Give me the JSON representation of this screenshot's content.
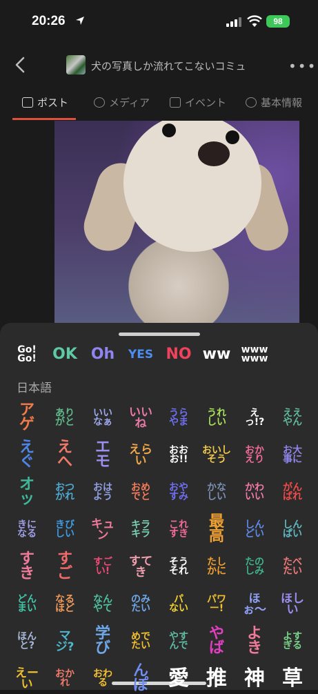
{
  "status": {
    "time": "20:26",
    "battery": "98"
  },
  "nav": {
    "group_title": "犬の写真しか流れてこないコミュ"
  },
  "tabs": [
    {
      "label": "ポスト",
      "icon": "post-icon"
    },
    {
      "label": "メディア",
      "icon": "media-icon"
    },
    {
      "label": "イベント",
      "icon": "calendar-icon"
    },
    {
      "label": "基本情報",
      "icon": "info-icon"
    }
  ],
  "colors": {
    "accent": "#e0503a",
    "sheet": "#2b2b2b",
    "background": "#1b1b1b"
  },
  "stickers": {
    "section_label": "日本語",
    "top_row": [
      {
        "text": "Go!\nGo!",
        "color": "#ffffff"
      },
      {
        "text": "OK",
        "color": "#5fc8a6"
      },
      {
        "text": "Oh",
        "color": "#8f84f0"
      },
      {
        "text": "YES",
        "color": "#4e8df0"
      },
      {
        "text": "NO",
        "color": "#f0425a"
      },
      {
        "text": "ww",
        "color": "#ffffff"
      },
      {
        "text": "www\nwww",
        "color": "#ffffff"
      }
    ],
    "grid": [
      [
        {
          "text": "アゲ",
          "color": "#f07a4a"
        },
        {
          "text": "あり\nがと",
          "color": "#5fb88a"
        },
        {
          "text": "いい\nなぁ",
          "color": "#9aa7e8"
        },
        {
          "text": "いいね",
          "color": "#e879a6"
        },
        {
          "text": "うら\nやま",
          "color": "#6f6ef0"
        },
        {
          "text": "うれ\nしい",
          "color": "#a8e05a"
        },
        {
          "text": "えっ!?",
          "color": "#ffffff"
        },
        {
          "text": "ええ\nやん",
          "color": "#5fb89a"
        }
      ],
      [
        {
          "text": "えぐ",
          "color": "#4f86e8"
        },
        {
          "text": "えへ",
          "color": "#f07a6a"
        },
        {
          "text": "エモ",
          "color": "#9c8ff0"
        },
        {
          "text": "えらい",
          "color": "#f0a64a"
        },
        {
          "text": "おお\nお!!",
          "color": "#ffffff"
        },
        {
          "text": "おいし\nそう",
          "color": "#f0c84a"
        },
        {
          "text": "おか\nえり",
          "color": "#f06a9a"
        },
        {
          "text": "お大\n事に",
          "color": "#8f84e8"
        }
      ],
      [
        {
          "text": "オッ",
          "color": "#3fb89a"
        },
        {
          "text": "おつ\nかれ",
          "color": "#4fa8d0"
        },
        {
          "text": "おは\nよう",
          "color": "#8f9ee0"
        },
        {
          "text": "おめ\nでと",
          "color": "#f07a5a"
        },
        {
          "text": "おや\nすみ",
          "color": "#6f6ef0"
        },
        {
          "text": "かな\nしい",
          "color": "#7a8fb0"
        },
        {
          "text": "かわ\nいい",
          "color": "#f07aa6"
        },
        {
          "text": "がん\nばれ",
          "color": "#f04a4a"
        }
      ],
      [
        {
          "text": "きに\nなる",
          "color": "#9f9fe8"
        },
        {
          "text": "きび\nしい",
          "color": "#3f9ae0"
        },
        {
          "text": "キュン",
          "color": "#f07a9a"
        },
        {
          "text": "キラ\nキラ",
          "color": "#7ad0b0"
        },
        {
          "text": "これ\nすき",
          "color": "#f06a9a"
        },
        {
          "text": "最高",
          "color": "#f0a030"
        },
        {
          "text": "しん\nどい",
          "color": "#5f8ae8"
        },
        {
          "text": "しん\nぱい",
          "color": "#5fb8c0"
        }
      ],
      [
        {
          "text": "すき",
          "color": "#f07a9a"
        },
        {
          "text": "すご",
          "color": "#f06a6a"
        },
        {
          "text": "すご\nい!",
          "color": "#f04a7a"
        },
        {
          "text": "すてき",
          "color": "#f0a0b0"
        },
        {
          "text": "そう\nそれ",
          "color": "#ffffff"
        },
        {
          "text": "たし\nかに",
          "color": "#f0a030"
        },
        {
          "text": "たの\nしみ",
          "color": "#3fb08a"
        },
        {
          "text": "たべ\nたい",
          "color": "#f07a7a"
        }
      ],
      [
        {
          "text": "どん\nまい",
          "color": "#3fc8a8"
        },
        {
          "text": "なる\nほど",
          "color": "#f09a5a"
        },
        {
          "text": "なん\nやて",
          "color": "#4fc0a0"
        },
        {
          "text": "のみ\nたい",
          "color": "#6fa8e8"
        },
        {
          "text": "パ\nない",
          "color": "#f0d030"
        },
        {
          "text": "パワー!",
          "color": "#f0c030"
        },
        {
          "text": "ほぉ〜",
          "color": "#8fa0f0"
        },
        {
          "text": "ほしい",
          "color": "#9a8ff0"
        }
      ],
      [
        {
          "text": "ほん\nと?",
          "color": "#a8b8d8"
        },
        {
          "text": "マジ?",
          "color": "#4fb8d0"
        },
        {
          "text": "学び",
          "color": "#6fa8e8"
        },
        {
          "text": "めで\nたい",
          "color": "#f0c030"
        },
        {
          "text": "やす\nんで",
          "color": "#5fb8a0"
        },
        {
          "text": "やば",
          "color": "#e040c0"
        },
        {
          "text": "よき",
          "color": "#f07a9a"
        },
        {
          "text": "よす\nぎる",
          "color": "#7ad08a"
        }
      ],
      [
        {
          "text": "えーい",
          "color": "#f0c030"
        },
        {
          "text": "おか\nれ",
          "color": "#f07a6a"
        },
        {
          "text": "おわ\nる",
          "color": "#f0c030"
        },
        {
          "text": "んぽ",
          "color": "#6f8ef0"
        },
        {
          "text": "愛",
          "color": "#ffffff"
        },
        {
          "text": "推",
          "color": "#ffffff"
        },
        {
          "text": "神",
          "color": "#ffffff"
        },
        {
          "text": "草",
          "color": "#ffffff"
        }
      ]
    ]
  }
}
